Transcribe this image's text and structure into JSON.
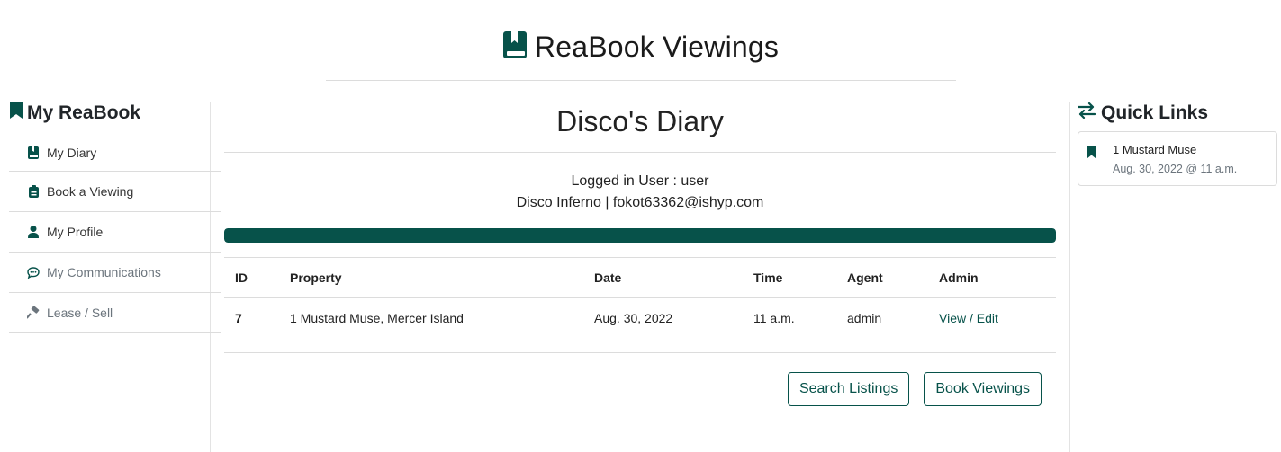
{
  "header": {
    "title": "ReaBook Viewings",
    "icon": "book-bookmark-icon"
  },
  "theme": {
    "accent": "#07524a",
    "muted": "#6c757d",
    "border": "#dcdcdc"
  },
  "sidebar": {
    "title": "My ReaBook",
    "items": [
      {
        "label": "My Diary",
        "icon": "book-icon"
      },
      {
        "label": "Book a Viewing",
        "icon": "clipboard-icon"
      },
      {
        "label": "My Profile",
        "icon": "user-icon"
      },
      {
        "label": "My Communications",
        "icon": "chat-icon"
      },
      {
        "label": "Lease / Sell",
        "icon": "hammer-icon"
      }
    ]
  },
  "main": {
    "title": "Disco's Diary",
    "user_line": "Logged in User : user",
    "contact_line": "Disco Inferno | fokot63362@ishyp.com",
    "progress": 1.0,
    "table": {
      "headers": [
        "ID",
        "Property",
        "Date",
        "Time",
        "Agent",
        "Admin"
      ],
      "rows": [
        {
          "id": "7",
          "property": "1 Mustard Muse, Mercer Island",
          "date": "Aug. 30, 2022",
          "time": "11 a.m.",
          "agent": "admin",
          "admin": "View / Edit"
        }
      ]
    },
    "buttons": {
      "search": "Search Listings",
      "book": "Book Viewings"
    }
  },
  "quick_links": {
    "title": "Quick Links",
    "items": [
      {
        "title": "1 Mustard Muse",
        "subtitle": "Aug. 30, 2022 @ 11 a.m."
      }
    ]
  }
}
